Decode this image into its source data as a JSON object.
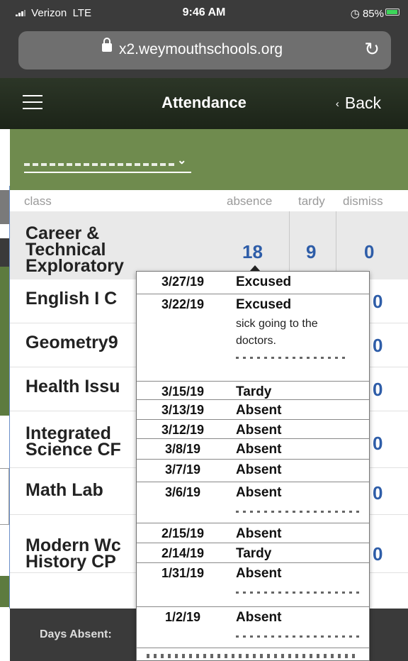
{
  "status_bar": {
    "carrier": "Verizon",
    "network": "LTE",
    "time": "9:46 AM",
    "battery": "85%"
  },
  "browser": {
    "url": "x2.weymouthschools.org"
  },
  "nav": {
    "title": "Attendance",
    "back_label": "Back"
  },
  "table": {
    "headers": {
      "class": "class",
      "absence": "absence",
      "tardy": "tardy",
      "dismiss": "dismiss"
    },
    "first_row": {
      "name_lines": [
        "Career &",
        "Technical",
        "Exploratory"
      ],
      "absence": "18",
      "tardy": "9",
      "dismiss": "0"
    },
    "rows": [
      {
        "name_lines": [
          "English I C"
        ]
      },
      {
        "name_lines": [
          "Geometry9"
        ]
      },
      {
        "name_lines": [
          "Health Issu"
        ]
      },
      {
        "name_lines": [
          "Integrated",
          "Science CF"
        ]
      },
      {
        "name_lines": [
          "Math Lab"
        ]
      },
      {
        "name_lines": [
          "Modern Wc",
          "History CP"
        ]
      }
    ]
  },
  "footer": {
    "days_absent_label": "Days Absent:"
  },
  "popover": {
    "entries": [
      {
        "date": "3/27/19",
        "status": "Excused"
      },
      {
        "date": "3/22/19",
        "status": "Excused",
        "note": "sick going to the doctors."
      },
      {
        "date": "3/15/19",
        "status": "Tardy"
      },
      {
        "date": "3/13/19",
        "status": "Absent"
      },
      {
        "date": "3/12/19",
        "status": "Absent"
      },
      {
        "date": "3/8/19",
        "status": "Absent"
      },
      {
        "date": "3/7/19",
        "status": "Absent"
      },
      {
        "date": "3/6/19",
        "status": "Absent"
      },
      {
        "date": "2/15/19",
        "status": "Absent"
      },
      {
        "date": "2/14/19",
        "status": "Tardy"
      },
      {
        "date": "1/31/19",
        "status": "Absent"
      },
      {
        "date": "1/2/19",
        "status": "Absent"
      }
    ]
  }
}
